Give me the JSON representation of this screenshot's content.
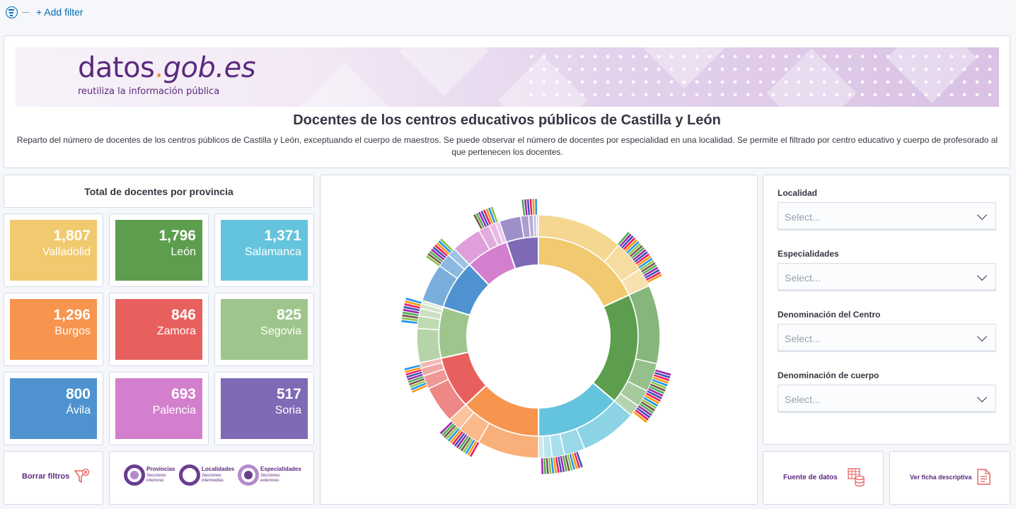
{
  "filter_bar": {
    "add_filter": "+ Add filter"
  },
  "header": {
    "logo_main": "datos",
    "logo_dot": ".",
    "logo_domain": "gob.es",
    "logo_tagline": "reutiliza la información pública",
    "title": "Docentes de los centros educativos públicos de Castilla y León",
    "description": "Reparto del número de docentes de los centros públicos de Castilla y León, exceptuando el cuerpo de maestros. Se puede observar el número de docentes por especialidad en una localidad. Se permite el filtrado por centro educativo y cuerpo de profesorado al que pertenecen los docentes."
  },
  "provinces_panel": {
    "title": "Total de docentes por provincia",
    "metrics": [
      {
        "value": "1,807",
        "label": "Valladolid",
        "color": "#f1c96e"
      },
      {
        "value": "1,796",
        "label": "León",
        "color": "#5c9e4e"
      },
      {
        "value": "1,371",
        "label": "Salamanca",
        "color": "#65c4dd"
      },
      {
        "value": "1,296",
        "label": "Burgos",
        "color": "#f7944d"
      },
      {
        "value": "846",
        "label": "Zamora",
        "color": "#e8605e"
      },
      {
        "value": "825",
        "label": "Segovia",
        "color": "#9ec68c"
      },
      {
        "value": "800",
        "label": "Ávila",
        "color": "#4e93cf"
      },
      {
        "value": "693",
        "label": "Palencia",
        "color": "#d47fce"
      },
      {
        "value": "517",
        "label": "Soria",
        "color": "#7f6ab5"
      }
    ]
  },
  "buttons": {
    "borrar_filtros": "Borrar filtros",
    "fuente_datos": "Fuente de datos",
    "ficha_descriptiva": "Ver ficha descriptiva"
  },
  "legend": [
    {
      "name": "Provincias",
      "sub": "Secciones interiores"
    },
    {
      "name": "Localidades",
      "sub": "Secciones intermedias"
    },
    {
      "name": "Especialidades",
      "sub": "Secciones exteriores"
    }
  ],
  "filters": [
    {
      "label": "Localidad",
      "placeholder": "Select..."
    },
    {
      "label": "Especialidades",
      "placeholder": "Select..."
    },
    {
      "label": "Denominación del Centro",
      "placeholder": "Select..."
    },
    {
      "label": "Denominación de cuerpo",
      "placeholder": "Select..."
    }
  ],
  "chart_data": {
    "type": "sunburst",
    "series": [
      {
        "name": "Valladolid",
        "value": 1807,
        "color": "#f1c96e"
      },
      {
        "name": "León",
        "value": 1796,
        "color": "#5c9e4e"
      },
      {
        "name": "Salamanca",
        "value": 1371,
        "color": "#65c4dd"
      },
      {
        "name": "Burgos",
        "value": 1296,
        "color": "#f7944d"
      },
      {
        "name": "Zamora",
        "value": 846,
        "color": "#e8605e"
      },
      {
        "name": "Segovia",
        "value": 825,
        "color": "#9ec68c"
      },
      {
        "name": "Ávila",
        "value": 800,
        "color": "#4e93cf"
      },
      {
        "name": "Palencia",
        "value": 693,
        "color": "#d47fce"
      },
      {
        "name": "Soria",
        "value": 517,
        "color": "#7f6ab5"
      }
    ]
  }
}
